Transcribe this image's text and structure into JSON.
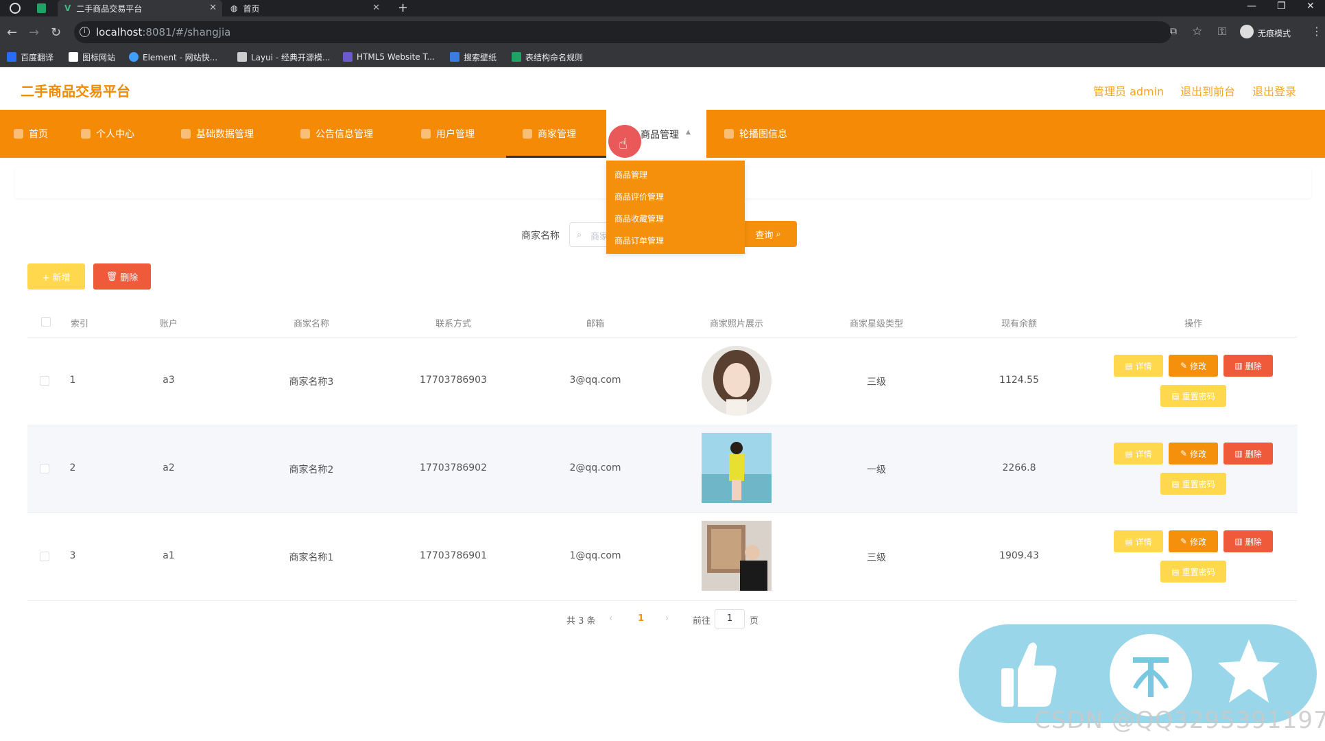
{
  "browser": {
    "tabs": [
      {
        "title": "二手商品交易平台"
      },
      {
        "title": "首页"
      }
    ],
    "url_host": "localhost",
    "url_rest": ":8081/#/shangjia",
    "incognito_label": "无痕模式",
    "bookmarks": [
      {
        "label": "百度翻译",
        "color": "#2b6cf6"
      },
      {
        "label": "图标网站",
        "color": "#ffffff"
      },
      {
        "label": "Element - 网站快...",
        "color": "#409eff"
      },
      {
        "label": "Layui - 经典开源模...",
        "color": "#cccccc"
      },
      {
        "label": "HTML5 Website T...",
        "color": "#6a5acd"
      },
      {
        "label": "搜索壁纸",
        "color": "#3c7be0"
      },
      {
        "label": "表结构命名规则",
        "color": "#21a366"
      }
    ]
  },
  "header": {
    "title": "二手商品交易平台",
    "admin": "管理员 admin",
    "exit_front": "退出到前台",
    "logout": "退出登录"
  },
  "nav": {
    "items": [
      "首页",
      "个人中心",
      "基础数据管理",
      "公告信息管理",
      "用户管理",
      "商家管理",
      "商品管理",
      "轮播图信息"
    ],
    "active": "商家管理",
    "hovered": "商品管理"
  },
  "dropdown": {
    "items": [
      "商品管理",
      "商品评价管理",
      "商品收藏管理",
      "商品订单管理"
    ]
  },
  "search": {
    "label": "商家名称",
    "placeholder": "商家名称",
    "button": "查询"
  },
  "actions": {
    "add": "+ 新增",
    "delete": "删除"
  },
  "table": {
    "headers": [
      "索引",
      "账户",
      "商家名称",
      "联系方式",
      "邮箱",
      "商家照片展示",
      "商家星级类型",
      "现有余额",
      "操作"
    ],
    "rows": [
      {
        "index": "1",
        "account": "a3",
        "name": "商家名称3",
        "phone": "17703786903",
        "email": "3@qq.com",
        "star": "三级",
        "balance": "1124.55"
      },
      {
        "index": "2",
        "account": "a2",
        "name": "商家名称2",
        "phone": "17703786902",
        "email": "2@qq.com",
        "star": "一级",
        "balance": "2266.8"
      },
      {
        "index": "3",
        "account": "a1",
        "name": "商家名称1",
        "phone": "17703786901",
        "email": "1@qq.com",
        "star": "三级",
        "balance": "1909.43"
      }
    ],
    "row_buttons": {
      "detail": "详情",
      "edit": "修改",
      "remove": "删除",
      "reset": "重置密码"
    }
  },
  "pagination": {
    "total": "共 3 条",
    "current": "1",
    "goto": "前往",
    "page_input": "1",
    "page_suffix": "页"
  },
  "overlay": {
    "icons": [
      "thumbs-up-icon",
      "coin-icon",
      "star-icon"
    ],
    "watermark": "CSDN @QQ3295391197"
  },
  "colors": {
    "nav_bg": "#f58a06",
    "brand": "#f08c00",
    "yellow_btn": "#ffd84d",
    "red_btn": "#ee5a3a"
  }
}
